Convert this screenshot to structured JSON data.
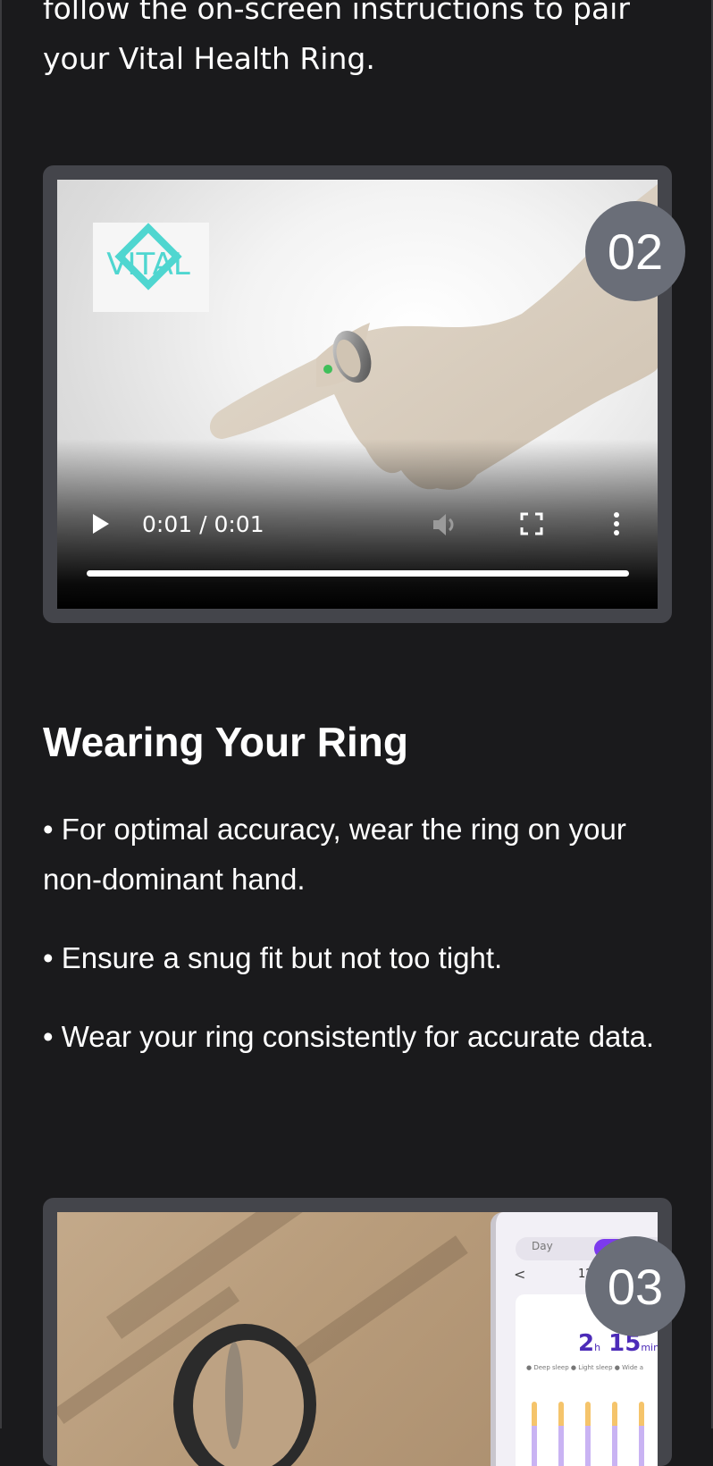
{
  "intro": {
    "text": "follow the on-screen instructions to pair your Vital Health Ring."
  },
  "video1": {
    "logo_text": "VITAL",
    "time": "0:01 / 0:01",
    "step_badge": "02",
    "progress": 1.0
  },
  "section": {
    "title": "Wearing Your Ring",
    "bullets": [
      "• For optimal accuracy, wear the ring on your non-dominant hand.",
      "• Ensure a snug fit but not too tight.",
      "• Wear your ring consistently for accurate data."
    ]
  },
  "video2": {
    "step_badge": "03",
    "phone": {
      "tab_day": "Day",
      "back": "<",
      "date": "12",
      "sleep_hours": "2",
      "sleep_h_unit": "h",
      "sleep_minutes": "15",
      "sleep_min_unit": "min",
      "legend": "● Deep sleep  ● Light sleep  ● Wide a"
    }
  },
  "colors": {
    "background": "#1a1a1c",
    "card": "#44454b",
    "badge": "#6a6e78",
    "logo": "#4fd6d0",
    "accent_purple": "#7c3aed"
  }
}
